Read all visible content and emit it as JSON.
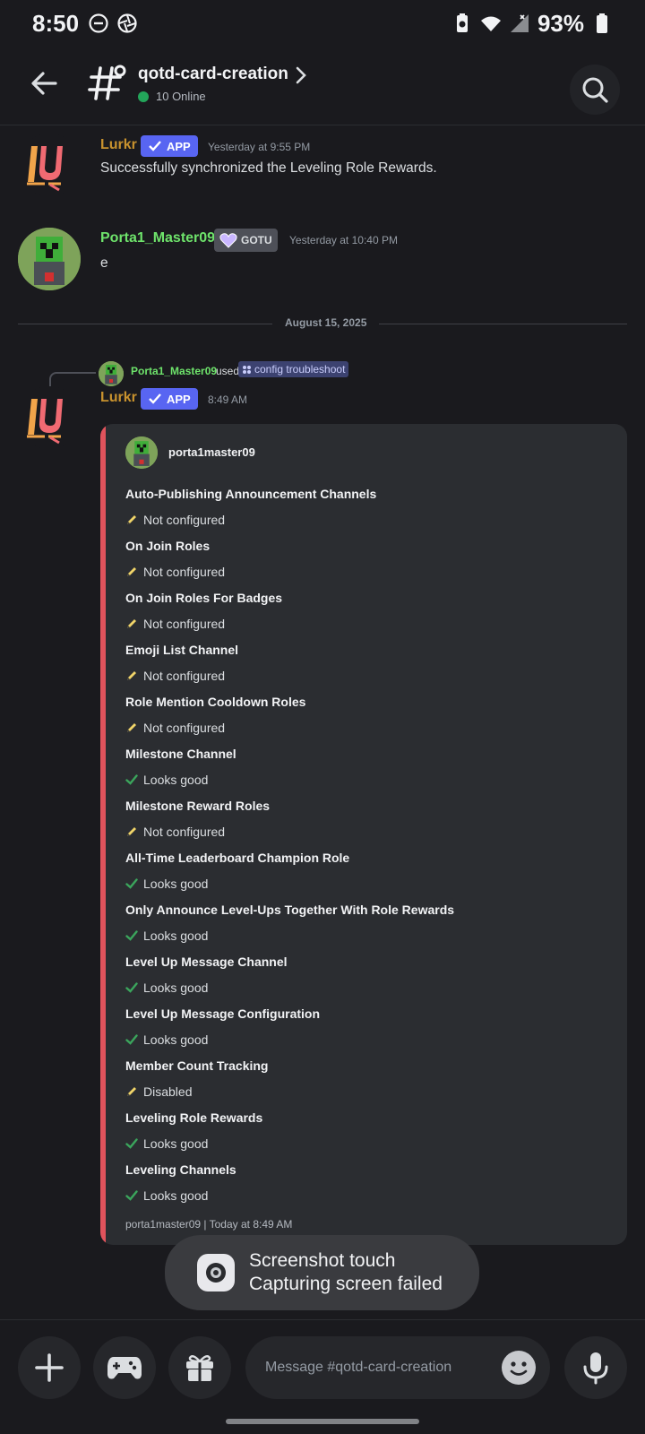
{
  "status_bar": {
    "time": "8:50",
    "battery_text": "93%",
    "icons": [
      "do-not-disturb-icon",
      "aperture-icon",
      "battery-saver-icon",
      "wifi-icon",
      "signal-icon",
      "battery-icon"
    ]
  },
  "header": {
    "channel_name": "qotd-card-creation",
    "online_text": "10 Online",
    "icons": [
      "back-arrow-icon",
      "thread-hash-icon",
      "chevron-right-icon",
      "search-icon"
    ]
  },
  "messages": [
    {
      "author": "Lurkr",
      "author_color": "#c8922e",
      "badge": "APP",
      "time": "Yesterday at 9:55 PM",
      "content": "Successfully synchronized the Leveling Role Rewards."
    },
    {
      "author": "Porta1_Master09",
      "author_color": "#6ee36b",
      "badge": "GOTU",
      "time": "Yesterday at 10:40 PM",
      "content": "e"
    }
  ],
  "date_divider": "August 15, 2025",
  "reply": {
    "user": "Porta1_Master09",
    "used_text": "used",
    "command": "config troubleshoot"
  },
  "bot_message": {
    "author": "Lurkr",
    "badge": "APP",
    "time": "8:49 AM"
  },
  "embed": {
    "author": "porta1master09",
    "accent_color": "#e0535c",
    "fields": [
      {
        "name": "Auto-Publishing Announcement Channels",
        "value": "Not configured",
        "icon": "pencil-icon"
      },
      {
        "name": "On Join Roles",
        "value": "Not configured",
        "icon": "pencil-icon"
      },
      {
        "name": "On Join Roles For Badges",
        "value": "Not configured",
        "icon": "pencil-icon"
      },
      {
        "name": "Emoji List Channel",
        "value": "Not configured",
        "icon": "pencil-icon"
      },
      {
        "name": "Role Mention Cooldown Roles",
        "value": "Not configured",
        "icon": "pencil-icon"
      },
      {
        "name": "Milestone Channel",
        "value": "Looks good",
        "icon": "check-icon"
      },
      {
        "name": "Milestone Reward Roles",
        "value": "Not configured",
        "icon": "pencil-icon"
      },
      {
        "name": "All-Time Leaderboard Champion Role",
        "value": "Looks good",
        "icon": "check-icon"
      },
      {
        "name": "Only Announce Level-Ups Together With Role Rewards",
        "value": "Looks good",
        "icon": "check-icon"
      },
      {
        "name": "Level Up Message Channel",
        "value": "Looks good",
        "icon": "check-icon"
      },
      {
        "name": "Level Up Message Configuration",
        "value": "Looks good",
        "icon": "check-icon"
      },
      {
        "name": "Member Count Tracking",
        "value": "Disabled",
        "icon": "pencil-icon"
      },
      {
        "name": "Leveling Role Rewards",
        "value": "Looks good",
        "icon": "check-icon"
      },
      {
        "name": "Leveling Channels",
        "value": "Looks good",
        "icon": "check-icon"
      }
    ],
    "footer": "porta1master09 | Today at 8:49 AM"
  },
  "toast": {
    "title": "Screenshot touch",
    "subtitle": "Capturing screen failed"
  },
  "composer": {
    "placeholder": "Message #qotd-card-creation",
    "icons": [
      "plus-icon",
      "gamepad-icon",
      "gift-icon",
      "emoji-icon",
      "microphone-icon"
    ]
  }
}
